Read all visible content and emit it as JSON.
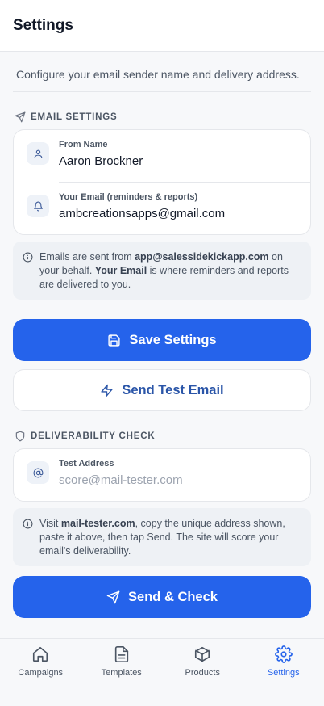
{
  "header": {
    "title": "Settings"
  },
  "subtitle": "Configure your email sender name and delivery address.",
  "email_settings": {
    "section_title": "EMAIL SETTINGS",
    "from_name_label": "From Name",
    "from_name_value": "Aaron Brockner",
    "your_email_label": "Your Email (reminders & reports)",
    "your_email_value": "ambcreationsapps@gmail.com",
    "info": {
      "t1": "Emails are sent from ",
      "sender": "app@salessidekickapp.com",
      "t2": " on your behalf. ",
      "your_email": "Your Email",
      "t3": " is where reminders and reports are delivered to you."
    }
  },
  "buttons": {
    "save": "Save Settings",
    "send_test": "Send Test Email",
    "send_check": "Send & Check"
  },
  "deliverability": {
    "section_title": "DELIVERABILITY CHECK",
    "test_address_label": "Test Address",
    "test_address_placeholder": "score@mail-tester.com",
    "info": {
      "t1": "Visit ",
      "site": "mail-tester.com",
      "t2": ", copy the unique address shown, paste it above, then tap Send. The site will score your email's deliverability."
    }
  },
  "tabs": [
    {
      "label": "Campaigns",
      "icon": "home-icon"
    },
    {
      "label": "Templates",
      "icon": "document-icon"
    },
    {
      "label": "Products",
      "icon": "box-icon"
    },
    {
      "label": "Settings",
      "icon": "gear-icon",
      "active": true
    }
  ],
  "colors": {
    "accent": "#2563eb",
    "outline_text": "#2a55a8"
  }
}
